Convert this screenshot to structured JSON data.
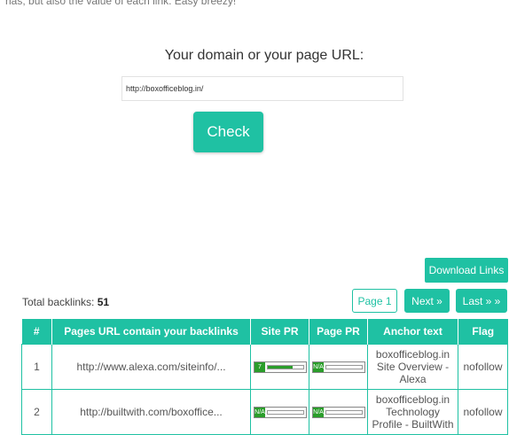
{
  "intro_text": "has, but also the value of each link. Easy breezy!",
  "form": {
    "label": "Your domain or your page URL:",
    "url_value": "http://boxofficeblog.in/",
    "check_label": "Check"
  },
  "download_label": "Download Links",
  "total": {
    "label": "Total backlinks:",
    "count": "51"
  },
  "pagination": {
    "page": "Page 1",
    "next": "Next »",
    "last": "Last » »"
  },
  "table": {
    "headers": [
      "#",
      "Pages URL contain your backlinks",
      "Site PR",
      "Page PR",
      "Anchor text",
      "Flag"
    ],
    "rows": [
      {
        "num": "1",
        "url": "http://www.alexa.com/siteinfo/...",
        "site_pr": {
          "label": "7",
          "fraction": 0.7
        },
        "page_pr": {
          "label": "N/A",
          "fraction": 0
        },
        "anchor": "boxofficeblog.in Site Overview - Alexa",
        "flag": "nofollow"
      },
      {
        "num": "2",
        "url": "http://builtwith.com/boxoffice...",
        "site_pr": {
          "label": "N/A",
          "fraction": 0
        },
        "page_pr": {
          "label": "N/A",
          "fraction": 0
        },
        "anchor": "boxofficeblog.in Technology Profile - BuiltWith",
        "flag": "nofollow"
      }
    ]
  },
  "colors": {
    "accent": "#1fc1a3",
    "link": "#1fae8e",
    "pr_green": "#2a9d2a"
  }
}
